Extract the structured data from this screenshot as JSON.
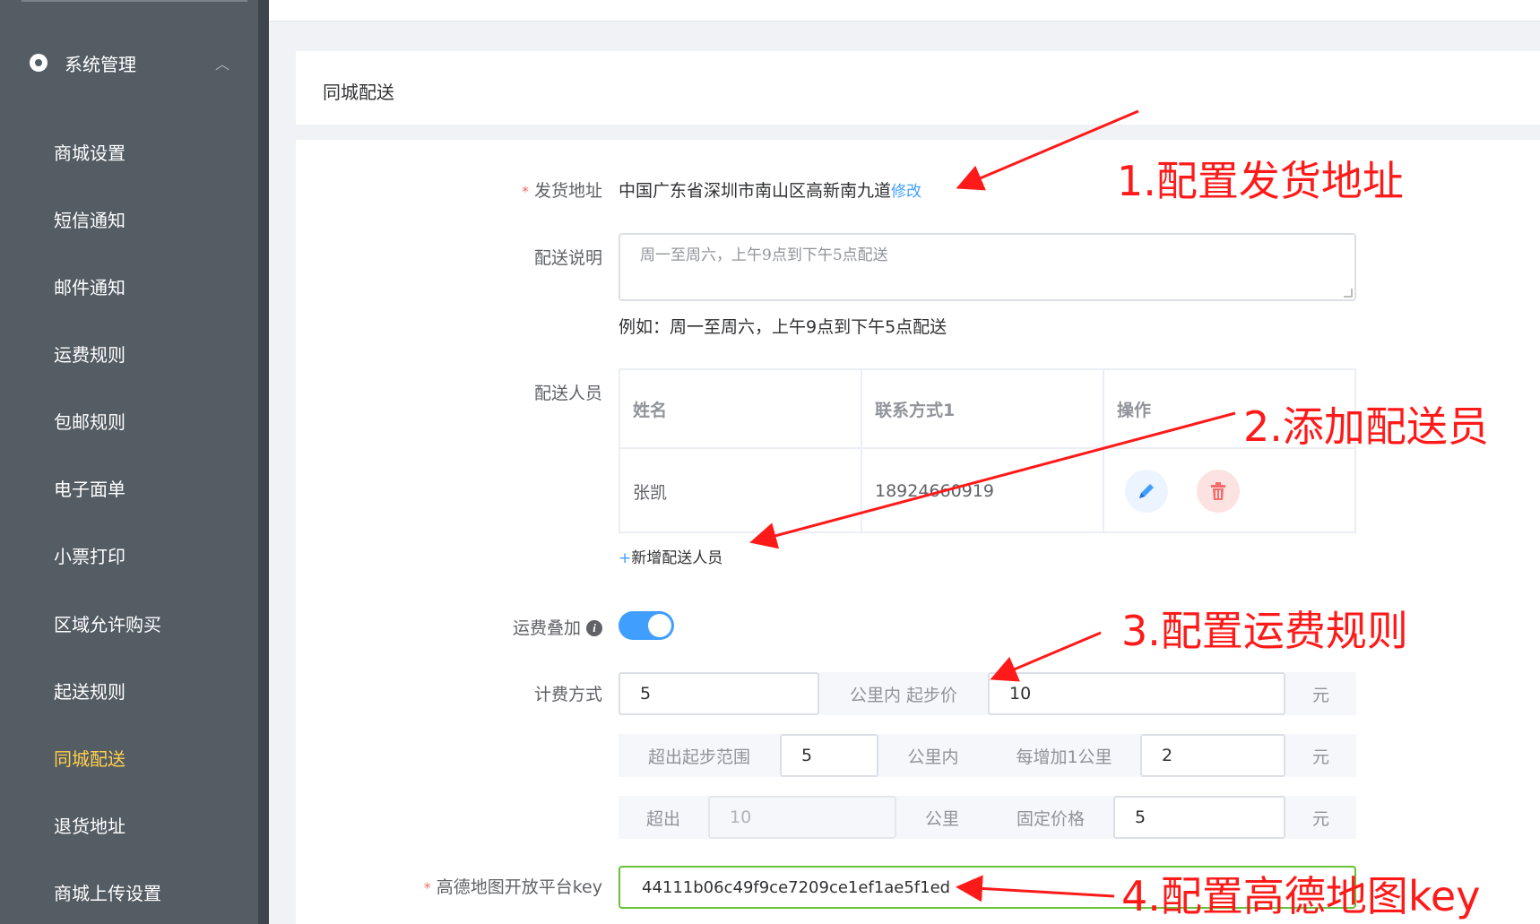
{
  "sidebar": {
    "group_label": "系统管理",
    "items": [
      {
        "label": "商城设置"
      },
      {
        "label": "短信通知"
      },
      {
        "label": "邮件通知"
      },
      {
        "label": "运费规则"
      },
      {
        "label": "包邮规则"
      },
      {
        "label": "电子面单"
      },
      {
        "label": "小票打印"
      },
      {
        "label": "区域允许购买"
      },
      {
        "label": "起送规则"
      },
      {
        "label": "同城配送",
        "active": true
      },
      {
        "label": "退货地址"
      },
      {
        "label": "商城上传设置"
      }
    ],
    "active_color": "#ffd04b"
  },
  "header": {
    "title": "同城配送"
  },
  "form": {
    "address": {
      "label": "发货地址",
      "value": "中国广东省深圳市南山区高新南九道",
      "edit_link": "修改"
    },
    "desc": {
      "label": "配送说明",
      "placeholder": "周一至周六，上午9点到下午5点配送",
      "hint": "例如：周一至周六，上午9点到下午5点配送"
    },
    "staff": {
      "label": "配送人员",
      "columns": [
        "姓名",
        "联系方式1",
        "操作"
      ],
      "rows": [
        {
          "name": "张凯",
          "phone": "18924660919"
        }
      ],
      "add_link": "新增配送人员"
    },
    "fee_stack": {
      "label": "运费叠加",
      "enabled": true
    },
    "billing": {
      "label": "计费方式",
      "row1": {
        "km": "5",
        "addon1": "公里内 起步价",
        "price": "10",
        "unit": "元"
      },
      "row2": {
        "addon1": "超出起步范围",
        "km": "5",
        "addon2": "公里内",
        "addon3": "每增加1公里",
        "price": "2",
        "unit": "元"
      },
      "row3": {
        "addon1": "超出",
        "km": "10",
        "addon2": "公里",
        "addon3": "固定价格",
        "price": "5",
        "unit": "元"
      }
    },
    "amap_key": {
      "label": "高德地图开放平台key",
      "value": "44111b06c49f9ce7209ce1ef1ae5f1ed"
    }
  },
  "annotations": {
    "step1": "1.配置发货地址",
    "step2": "2.添加配送员",
    "step3": "3.配置运费规则",
    "step4": "4.配置高德地图key"
  },
  "colors": {
    "primary": "#409eff",
    "danger": "#f56c6c",
    "success": "#67c23a",
    "annotation": "#ff1a1a",
    "sidebar_bg": "#545c64"
  }
}
